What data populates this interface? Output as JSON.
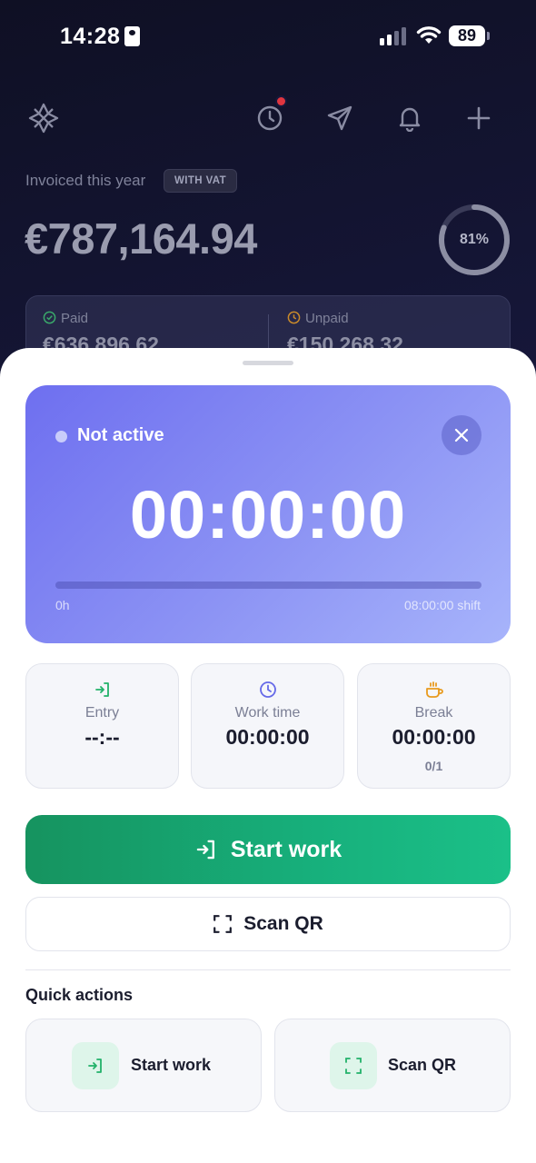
{
  "status_bar": {
    "time": "14:28",
    "battery": "89"
  },
  "header": {
    "icons": [
      "logo-icon",
      "history-icon",
      "send-icon",
      "bell-icon",
      "plus-icon"
    ],
    "invoiced_label": "Invoiced this year",
    "vat_badge": "WITH VAT",
    "amount": "€787,164.94",
    "progress_percent": 81,
    "progress_label": "81%",
    "paid_label": "Paid",
    "paid_value": "€636,896.62",
    "unpaid_label": "Unpaid",
    "unpaid_value": "€150,268.32"
  },
  "timer": {
    "status": "Not active",
    "display": "00:00:00",
    "progress_fraction": 0,
    "start_label": "0h",
    "shift_label": "08:00:00 shift"
  },
  "stats": [
    {
      "label": "Entry",
      "value": "--:--",
      "icon": "enter-icon"
    },
    {
      "label": "Work time",
      "value": "00:00:00",
      "icon": "clock-icon"
    },
    {
      "label": "Break",
      "value": "00:00:00",
      "sub": "0/1",
      "icon": "coffee-icon"
    }
  ],
  "actions": {
    "start_work": "Start work",
    "scan_qr": "Scan QR"
  },
  "quick_actions": {
    "title": "Quick actions",
    "items": [
      {
        "label": "Start work",
        "icon": "enter-icon"
      },
      {
        "label": "Scan QR",
        "icon": "scan-icon"
      }
    ]
  },
  "colors": {
    "accent_green": "#17b07c",
    "timer_gradient_start": "#6e6ff0",
    "timer_gradient_end": "#a7b4fb",
    "header_bg": "#16173a"
  }
}
